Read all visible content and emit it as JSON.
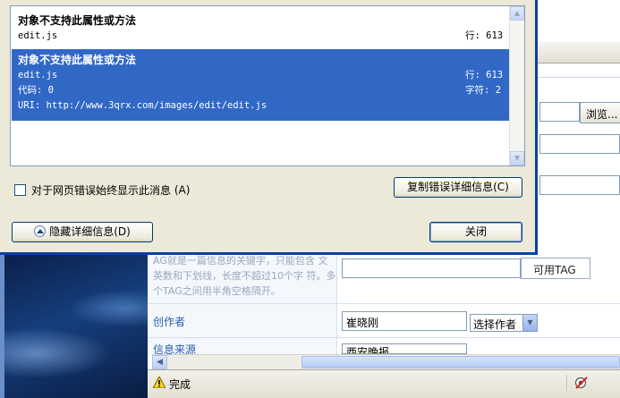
{
  "dialog": {
    "messages": [
      {
        "title": "对象不支持此属性或方法",
        "file": "edit.js",
        "line": "行: 613"
      },
      {
        "title": "对象不支持此属性或方法",
        "file": "edit.js",
        "line": "行: 613",
        "code": "代码: 0",
        "char": "字符: 2",
        "uri": "URI: http://www.3qrx.com/images/edit/edit.js"
      }
    ],
    "always_show_label": "对于网页错误始终显示此消息",
    "always_show_accel": "(A)",
    "copy_button": "复制错误详细信息(C)",
    "hide_details_button": "隐藏详细信息(D)",
    "close_button": "关闭"
  },
  "browser": {
    "browse_button": "浏览...",
    "tag_hint": "AG就是一篇信息的关键字，只能包含 文英数和下划线，长度不超过10个字 符。多个TAG之间用半角空格隔开。",
    "available_tag_button": "可用TAG",
    "author_label": "创作者",
    "author_value": "崔晓刚",
    "author_select": "选择作者",
    "source_label": "信息来源",
    "source_value": "西安晚报",
    "status_text": "完成"
  }
}
